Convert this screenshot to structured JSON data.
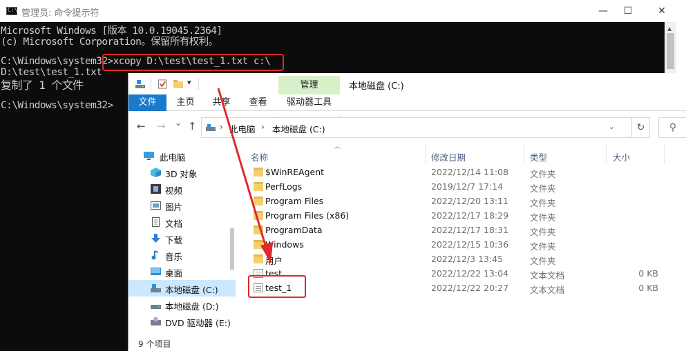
{
  "console": {
    "title": "管理员: 命令提示符",
    "icon": "C:\\",
    "controls": {
      "minimize": "—",
      "maximize": "☐",
      "close": "✕"
    },
    "lines": [
      "Microsoft Windows [版本 10.0.19045.2364]",
      "(c) Microsoft Corporation。保留所有权利。",
      "",
      "C:\\Windows\\system32>xcopy D:\\test\\test_1.txt c:\\",
      "D:\\test\\test_1.txt",
      "复制了 1 个文件",
      "",
      "C:\\Windows\\system32>"
    ]
  },
  "explorer": {
    "title": "本地磁盘 (C:)",
    "qat_dropdown": "▾",
    "ribbon": {
      "context_group": "管理",
      "tabs": [
        "文件",
        "主页",
        "共享",
        "查看"
      ],
      "context_tab": "驱动器工具"
    },
    "nav": {
      "back": "←",
      "forward": "→",
      "down": "⌄",
      "up": "↑"
    },
    "address": {
      "sep": "›",
      "crumbs": [
        "此电脑",
        "本地磁盘 (C:)"
      ],
      "dropdown": "⌄",
      "refresh": "↻",
      "search_icon": "⚲"
    },
    "sidebar": [
      {
        "label": "此电脑",
        "icon": "pc-icon",
        "selected": false
      },
      {
        "label": "3D 对象",
        "icon": "cube-icon",
        "selected": false
      },
      {
        "label": "视频",
        "icon": "video-icon",
        "selected": false
      },
      {
        "label": "图片",
        "icon": "picture-icon",
        "selected": false
      },
      {
        "label": "文档",
        "icon": "document-icon",
        "selected": false
      },
      {
        "label": "下载",
        "icon": "download-icon",
        "selected": false
      },
      {
        "label": "音乐",
        "icon": "music-icon",
        "selected": false
      },
      {
        "label": "桌面",
        "icon": "desktop-icon",
        "selected": false
      },
      {
        "label": "本地磁盘 (C:)",
        "icon": "drive-icon",
        "selected": true
      },
      {
        "label": "本地磁盘 (D:)",
        "icon": "drive-icon",
        "selected": false
      },
      {
        "label": "DVD 驱动器 (E:)",
        "icon": "dvd-icon",
        "selected": false
      }
    ],
    "columns": {
      "name": "名称",
      "modified": "修改日期",
      "type": "类型",
      "size": "大小"
    },
    "files": [
      {
        "name": "$WinREAgent",
        "modified": "2022/12/14 11:08",
        "type": "文件夹",
        "size": "",
        "kind": "folder"
      },
      {
        "name": "PerfLogs",
        "modified": "2019/12/7 17:14",
        "type": "文件夹",
        "size": "",
        "kind": "folder"
      },
      {
        "name": "Program Files",
        "modified": "2022/12/20 13:11",
        "type": "文件夹",
        "size": "",
        "kind": "folder"
      },
      {
        "name": "Program Files (x86)",
        "modified": "2022/12/17 18:29",
        "type": "文件夹",
        "size": "",
        "kind": "folder"
      },
      {
        "name": "ProgramData",
        "modified": "2022/12/17 18:31",
        "type": "文件夹",
        "size": "",
        "kind": "folder"
      },
      {
        "name": "Windows",
        "modified": "2022/12/15 10:36",
        "type": "文件夹",
        "size": "",
        "kind": "folder"
      },
      {
        "name": "用户",
        "modified": "2022/12/3 13:45",
        "type": "文件夹",
        "size": "",
        "kind": "folder"
      },
      {
        "name": "test",
        "modified": "2022/12/22 13:04",
        "type": "文本文档",
        "size": "0 KB",
        "kind": "text"
      },
      {
        "name": "test_1",
        "modified": "2022/12/22 20:27",
        "type": "文本文档",
        "size": "0 KB",
        "kind": "text"
      }
    ],
    "status": "9 个项目"
  },
  "colors": {
    "console_bg": "#0c0c0c",
    "console_text": "#cccccc",
    "annotation": "#e0282e",
    "file_tab": "#1979ca",
    "context_tab": "#d8f0c8",
    "selection": "#cce8ff"
  }
}
